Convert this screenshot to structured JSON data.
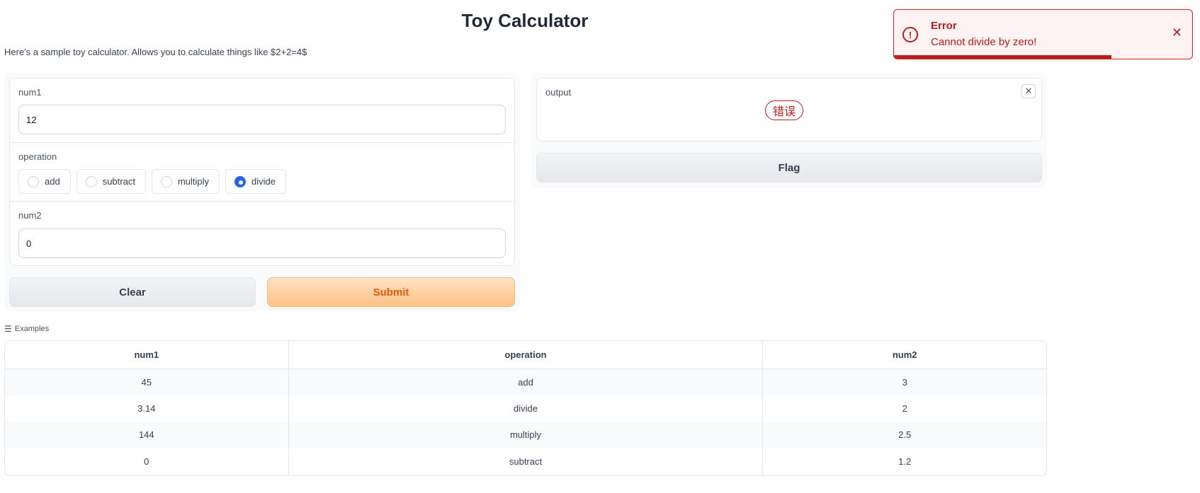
{
  "page": {
    "title": "Toy Calculator",
    "description": "Here's a sample toy calculator. Allows you to calculate things like $2+2=4$"
  },
  "inputs": {
    "num1": {
      "label": "num1",
      "value": "12"
    },
    "operation": {
      "label": "operation",
      "options": [
        "add",
        "subtract",
        "multiply",
        "divide"
      ],
      "selected": "divide"
    },
    "num2": {
      "label": "num2",
      "value": "0"
    }
  },
  "buttons": {
    "clear": "Clear",
    "submit": "Submit",
    "flag": "Flag"
  },
  "output": {
    "label": "output",
    "value": "错误"
  },
  "examples": {
    "label": "Examples",
    "headers": [
      "num1",
      "operation",
      "num2"
    ],
    "rows": [
      [
        "45",
        "add",
        "3"
      ],
      [
        "3.14",
        "divide",
        "2"
      ],
      [
        "144",
        "multiply",
        "2.5"
      ],
      [
        "0",
        "subtract",
        "1.2"
      ]
    ]
  },
  "toast": {
    "title": "Error",
    "message": "Cannot divide by zero!",
    "progress": 0.73,
    "colors": {
      "accent": "#b91c1c",
      "background": "#fef2f2"
    },
    "icons": {
      "status": "alert-circle-icon",
      "close": "close-icon"
    }
  },
  "colors": {
    "submit_accent": "#ea580c",
    "radio_checked": "#2563eb"
  }
}
